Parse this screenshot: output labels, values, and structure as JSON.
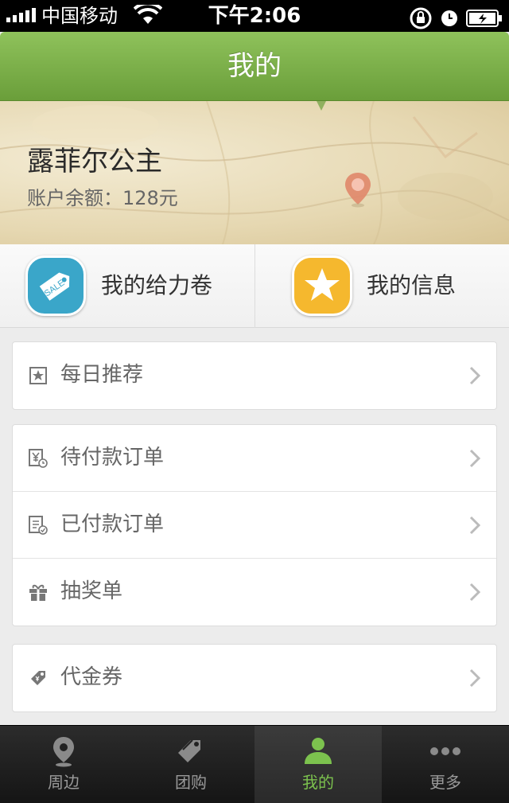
{
  "status_bar": {
    "carrier": "中国移动",
    "time": "下午2:06"
  },
  "header": {
    "title": "我的"
  },
  "profile": {
    "user_name": "露菲尔公主",
    "balance": "账户余额：128元"
  },
  "quick_actions": [
    {
      "label": "我的给力卷",
      "icon": "sale-tag-icon",
      "color": "#3aa6c9"
    },
    {
      "label": "我的信息",
      "icon": "star-icon",
      "color": "#f5b82e"
    }
  ],
  "groups": [
    {
      "items": [
        {
          "label": "每日推荐",
          "icon": "star-box-icon"
        }
      ]
    },
    {
      "items": [
        {
          "label": "待付款订单",
          "icon": "unpaid-order-icon"
        },
        {
          "label": "已付款订单",
          "icon": "paid-order-icon"
        },
        {
          "label": "抽奖单",
          "icon": "gift-icon"
        }
      ]
    },
    {
      "items": [
        {
          "label": "代金券",
          "icon": "voucher-tag-icon"
        }
      ]
    }
  ],
  "tabbar": {
    "tabs": [
      {
        "label": "周边",
        "icon": "location-pin-icon",
        "active": false
      },
      {
        "label": "团购",
        "icon": "tag-icon",
        "active": false
      },
      {
        "label": "我的",
        "icon": "person-icon",
        "active": true
      },
      {
        "label": "更多",
        "icon": "more-dots-icon",
        "active": false
      }
    ]
  },
  "colors": {
    "accent_green": "#7cc24e",
    "header_green": "#6a9e3a"
  }
}
